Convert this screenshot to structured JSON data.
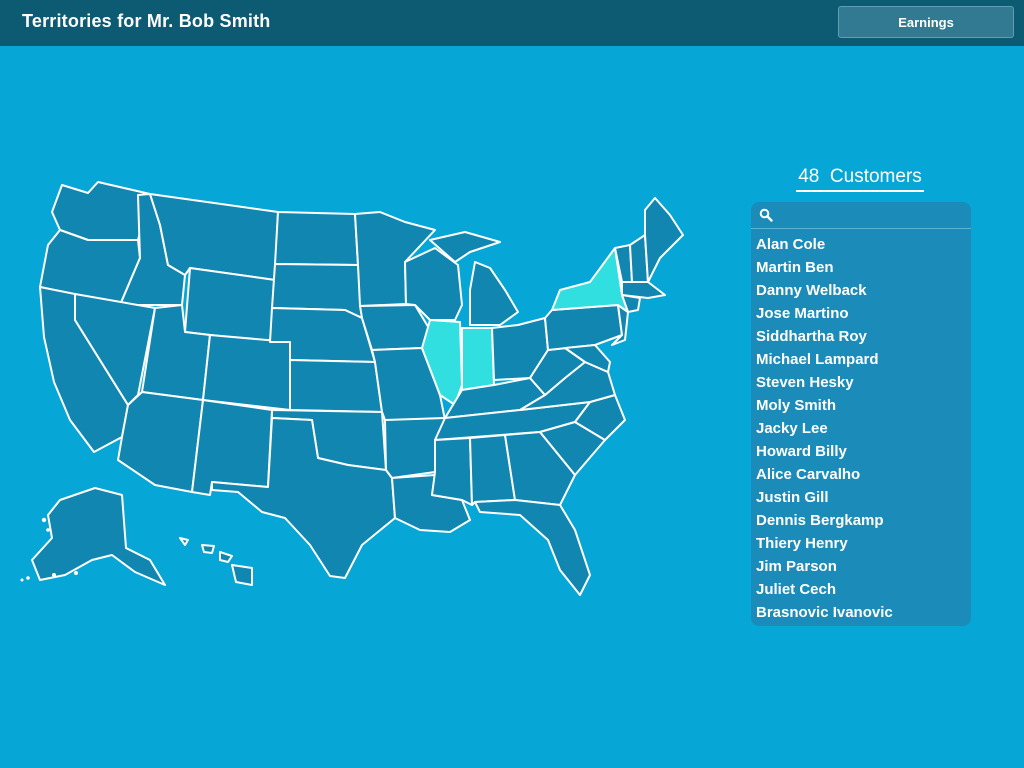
{
  "header": {
    "title": "Territories for Mr. Bob Smith",
    "earnings_label": "Earnings"
  },
  "map": {
    "highlighted_states": [
      "Illinois",
      "Indiana",
      "New York"
    ],
    "base_color": "#1186b0",
    "highlight_color": "#32dfe0",
    "border_color": "#ffffff"
  },
  "customers": {
    "count": "48",
    "label": "Customers",
    "search": {
      "icon": "search-icon",
      "value": "",
      "placeholder": ""
    },
    "list": [
      "Alan Cole",
      "Martin Ben",
      "Danny Welback",
      "Jose Martino",
      "Siddhartha Roy",
      "Michael Lampard",
      "Steven Hesky",
      "Moly Smith",
      "Jacky Lee",
      "Howard Billy",
      "Alice Carvalho",
      "Justin Gill",
      "Dennis Bergkamp",
      "Thiery Henry",
      "Jim Parson",
      "Juliet Cech",
      "Brasnovic Ivanovic"
    ]
  },
  "colors": {
    "background": "#06a6d6",
    "header": "#0d5a73",
    "panel": "#1b8cb9",
    "button": "#317a92"
  }
}
